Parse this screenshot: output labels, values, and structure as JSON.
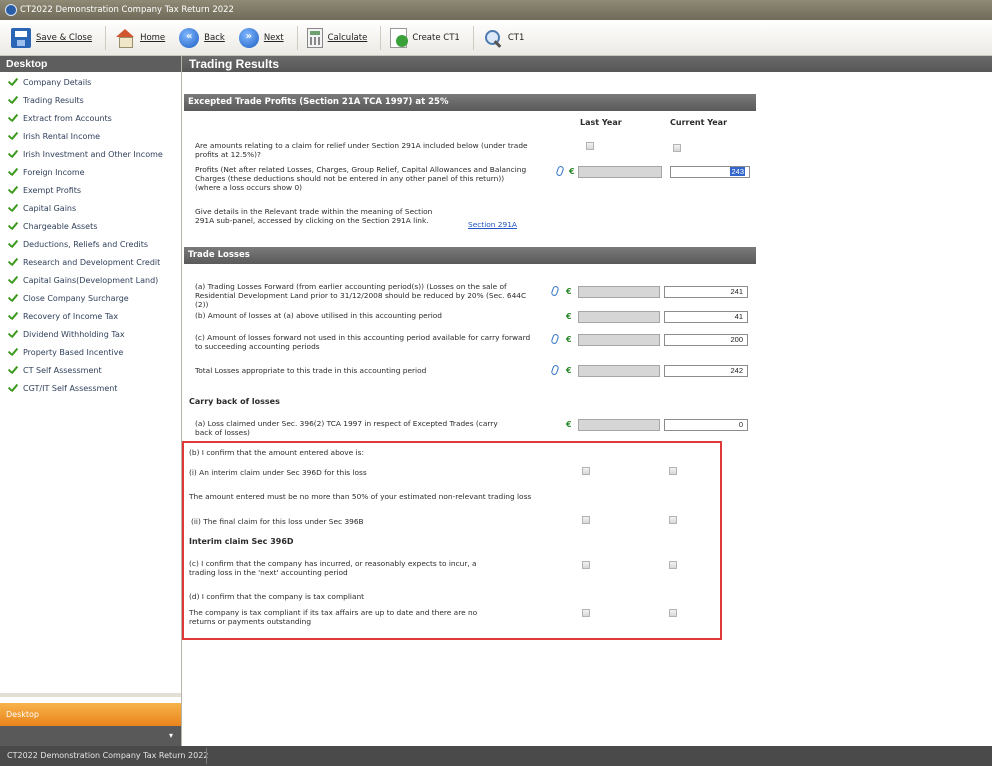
{
  "window": {
    "title": "CT2022 Demonstration Company Tax Return 2022",
    "icon": "app-icon"
  },
  "toolbar": {
    "save_close": "Save & Close",
    "home": "Home",
    "back": "Back",
    "next": "Next",
    "calculate": "Calculate",
    "create_ct1": "Create CT1",
    "ct1": "CT1"
  },
  "sidebar": {
    "header": "Desktop",
    "items": [
      "Company Details",
      "Trading Results",
      "Extract from Accounts",
      "Irish Rental Income",
      "Irish Investment and Other Income",
      "Foreign Income",
      "Exempt Profits",
      "Capital Gains",
      "Chargeable Assets",
      "Deductions, Reliefs and Credits",
      "Research and Development Credit",
      "Capital Gains(Development Land)",
      "Close Company Surcharge",
      "Recovery of Income Tax",
      "Dividend Withholding Tax",
      "Property Based Incentive",
      "CT Self Assessment",
      "CGT/IT Self Assessment"
    ],
    "desktop_button": "Desktop"
  },
  "main": {
    "title": "Trading Results",
    "excepted": {
      "header": "Excepted Trade Profits (Section 21A TCA 1997) at 25%",
      "col_last": "Last Year",
      "col_current": "Current Year",
      "q1_line1": "Are amounts relating to a claim for relief under Section 291A included below (under trade",
      "q1_line2": "profits at 12.5%)?",
      "profits_line1": "Profits (Net after related Losses, Charges, Group Relief, Capital Allowances and Balancing",
      "profits_line2": "Charges (these deductions should not be entered in any other panel of this return))",
      "profits_line3": "(where a loss occurs show 0)",
      "profits_current": "243",
      "details_line1": "Give details in the Relevant trade within the meaning of Section",
      "details_line2": "291A sub-panel, accessed by clicking on the Section 291A link.",
      "section_link": "Section 291A"
    },
    "losses": {
      "header": "Trade Losses",
      "a_line1": "(a) Trading Losses Forward (from earlier accounting period(s)) (Losses on the sale of",
      "a_line2": "Residential Development Land prior to 31/12/2008 should be reduced by 20% (Sec. 644C",
      "a_line3": "(2))",
      "a_value": "241",
      "b_line": "(b) Amount of losses at (a) above utilised in this accounting period",
      "b_value": "41",
      "c_line1": "(c) Amount of losses forward not used in this accounting period available for carry forward",
      "c_line2": "to succeeding accounting periods",
      "c_value": "200",
      "total_line": "Total Losses appropriate to this trade in this accounting period",
      "total_value": "242"
    },
    "carry_back": {
      "title": "Carry back of losses",
      "a_line1": "(a) Loss claimed under Sec. 396(2) TCA 1997 in respect of Excepted Trades (carry",
      "a_line2": "back of losses)",
      "a_value": "0",
      "b_confirm": "(b) I confirm that the amount entered above is:",
      "i_interim": "(i) An interim claim under Sec 396D for this loss",
      "note_50": "The amount entered must be no more than 50% of your estimated non-relevant trading loss",
      "ii_final": "(ii) The final claim for this loss under Sec 396B",
      "interim_title": "Interim claim Sec 396D",
      "c_line1": "(c) I confirm that the company has incurred, or reasonably expects to incur, a",
      "c_line2": "trading loss in the 'next' accounting period",
      "d_line": "(d) I confirm that the company is tax compliant",
      "compliant_line1": "The company is tax compliant if its tax affairs are up to date and there are no",
      "compliant_line2": "returns or payments outstanding"
    },
    "currency_symbol": "€"
  },
  "statusbar": {
    "text": "CT2022 Demonstration Company Tax Return 2022"
  }
}
